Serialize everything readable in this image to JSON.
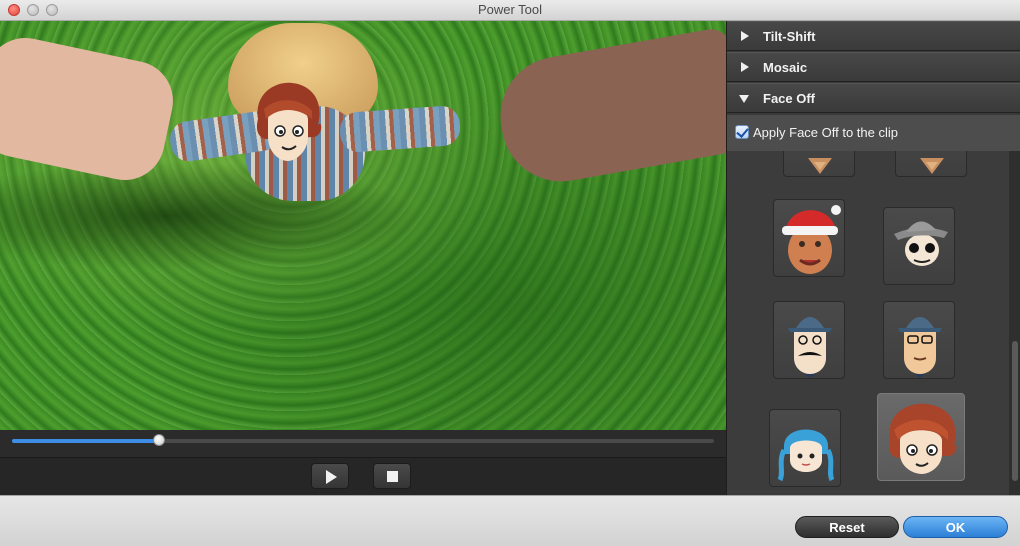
{
  "window": {
    "title": "Power Tool"
  },
  "player": {
    "progress": 0.21
  },
  "panel": {
    "sections": [
      {
        "label": "Tilt-Shift",
        "expanded": false
      },
      {
        "label": "Mosaic",
        "expanded": false
      },
      {
        "label": "Face Off",
        "expanded": true
      }
    ],
    "apply_checkbox": {
      "label": "Apply Face Off to the clip",
      "checked": true
    },
    "stickers": [
      {
        "name": "beard-face",
        "selected": false
      },
      {
        "name": "beard-face-2",
        "selected": false
      },
      {
        "name": "santa-hat-face",
        "selected": false
      },
      {
        "name": "fedora-sunglasses-face",
        "selected": false
      },
      {
        "name": "hat-mustache-face",
        "selected": false
      },
      {
        "name": "hat-glasses-face",
        "selected": false
      },
      {
        "name": "blue-hair-girl-face",
        "selected": false
      },
      {
        "name": "red-hair-anime-face",
        "selected": true
      }
    ]
  },
  "footer": {
    "reset_label": "Reset",
    "ok_label": "OK"
  },
  "colors": {
    "accent": "#3e8ee8",
    "ok_button": "#2b7fd6",
    "panel_bg": "#3a3a3a"
  }
}
